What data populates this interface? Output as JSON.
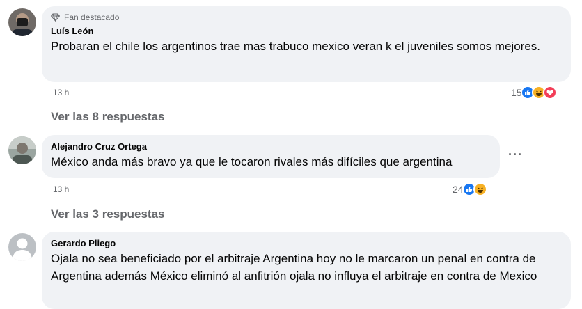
{
  "comments": [
    {
      "badge": "Fan destacado",
      "author": "Luís León",
      "text": "Probaran el chile los argentinos trae mas trabuco mexico veran k el juveniles somos mejores.",
      "time": "13 h",
      "reaction_count": "15",
      "reactions": [
        "like-icon",
        "haha-icon",
        "love-icon"
      ],
      "replies": "Ver las 8 respuestas"
    },
    {
      "author": "Alejandro Cruz Ortega",
      "text": "México anda más bravo ya que le tocaron rivales más difíciles que argentina",
      "time": "13 h",
      "reaction_count": "24",
      "reactions": [
        "like-icon",
        "haha-icon"
      ],
      "replies": "Ver las 3 respuestas",
      "more_label": "···"
    },
    {
      "author": "Gerardo Pliego",
      "text": "Ojala no sea beneficiado por el arbitraje Argentina hoy no le marcaron un penal en contra de Argentina además México eliminó al anfitrión ojala no influya el arbitraje en contra de Mexico"
    }
  ],
  "colors": {
    "like": "#1877f2",
    "haha": "#f7b125",
    "love": "#f33e58",
    "bubble": "#f0f2f5",
    "muted": "#65676b"
  }
}
